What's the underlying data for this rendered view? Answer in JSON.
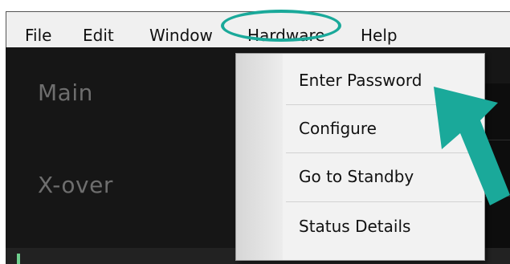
{
  "menubar": {
    "items": [
      {
        "label": "File"
      },
      {
        "label": "Edit"
      },
      {
        "label": "Window"
      },
      {
        "label": "Hardware"
      },
      {
        "label": "Help"
      }
    ]
  },
  "sidebar": {
    "items": [
      {
        "label": "Main"
      },
      {
        "label": "X-over"
      }
    ]
  },
  "hardware_menu": {
    "items": [
      {
        "label": "Enter Password"
      },
      {
        "label": "Configure"
      },
      {
        "label": "Go to Standby"
      },
      {
        "label": "Status Details"
      }
    ]
  },
  "annotation": {
    "accent_color": "#1aa99a",
    "highlighted_menu": "Hardware",
    "arrow_target": "Enter Password"
  }
}
